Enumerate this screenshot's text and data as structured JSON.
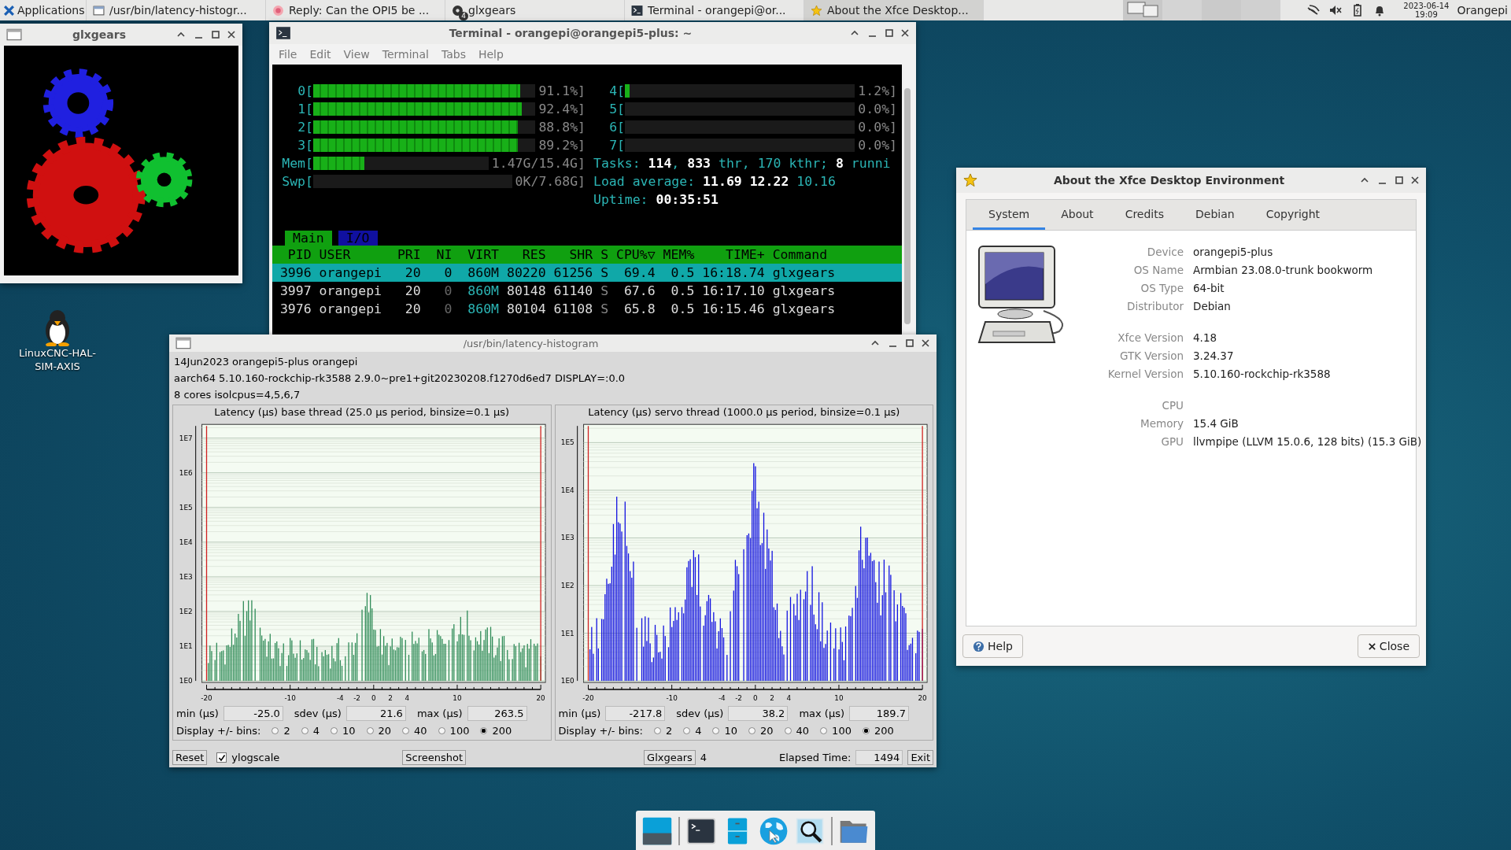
{
  "panel": {
    "tasks": [
      {
        "label": "Applications",
        "kind": "menu",
        "selected": false
      },
      {
        "label": "/usr/bin/latency-histogr...",
        "kind": "window",
        "selected": false
      },
      {
        "label": "Reply: Can the OPI5 be ...",
        "kind": "browser",
        "selected": false
      },
      {
        "label": "glxgears",
        "kind": "gears",
        "badge": "4",
        "selected": false
      },
      {
        "label": "Terminal - orangepi@or...",
        "kind": "terminal",
        "selected": false
      },
      {
        "label": "About the Xfce Desktop...",
        "kind": "star",
        "selected": true
      }
    ],
    "clock": {
      "date": "2023-06-14",
      "time": "19:09"
    },
    "user": "Orangepi"
  },
  "glxgears": {
    "title": "glxgears"
  },
  "desktop_icons": [
    {
      "label": "LinuxCNC-HAL-SIM-AXIS"
    }
  ],
  "terminal": {
    "title": "Terminal - orangepi@orangepi5-plus: ~",
    "menu": [
      "File",
      "Edit",
      "View",
      "Terminal",
      "Tabs",
      "Help"
    ],
    "left_meters": [
      {
        "label": "0[",
        "level": 0.93,
        "reading": "91.1%]"
      },
      {
        "label": "1[",
        "level": 0.94,
        "reading": "92.4%]"
      },
      {
        "label": "2[",
        "level": 0.92,
        "reading": "88.8%]"
      },
      {
        "label": "3[",
        "level": 0.92,
        "reading": "89.2%]"
      },
      {
        "label": "Mem[",
        "level": 0.29,
        "reading": "1.47G/15.4G]"
      },
      {
        "label": "Swp[",
        "reading": "0K/7.68G]"
      }
    ],
    "right_meters": [
      {
        "label": "4[",
        "level": 0.02,
        "reading": "1.2%]"
      },
      {
        "label": "5[",
        "reading": "0.0%]"
      },
      {
        "label": "6[",
        "reading": "0.0%]"
      },
      {
        "label": "7[",
        "reading": "0.0%]"
      }
    ],
    "stats": [
      "Tasks: **114**, **833** thr, 170 kthr; **8** runni",
      "Load average: **11.69 12.22** 10.16",
      "Uptime: **00:35:51**"
    ],
    "tabs": [
      {
        "label": "Main",
        "selected": true
      },
      {
        "label": "I/O",
        "selected": false
      }
    ],
    "columns": [
      "PID",
      "USER",
      "PRI",
      "NI",
      "VIRT",
      "RES",
      "SHR",
      "S",
      "CPU%▽",
      "MEM%",
      "TIME+",
      "Command"
    ],
    "rows": [
      {
        "selected": true,
        "cells": [
          "3996",
          "orangepi",
          "20",
          "0",
          "860M",
          "80220",
          "61256",
          "S",
          "69.4",
          "0.5",
          "16:18.74",
          "glxgears"
        ]
      },
      {
        "selected": false,
        "cells": [
          "3997",
          "orangepi",
          "20",
          "0",
          "860M",
          "80148",
          "61140",
          "S",
          "67.6",
          "0.5",
          "16:17.10",
          "glxgears"
        ]
      },
      {
        "selected": false,
        "cells": [
          "3976",
          "orangepi",
          "20",
          "0",
          "860M",
          "80104",
          "61108",
          "S",
          "65.8",
          "0.5",
          "16:15.46",
          "glxgears"
        ]
      }
    ]
  },
  "histogram": {
    "title": "/usr/bin/latency-histogram",
    "info": [
      "14Jun2023 orangepi5-plus orangepi",
      "aarch64  5.10.160-rockchip-rk3588  2.9.0~pre1+git20230208.f1270d6ed7  DISPLAY=:0.0",
      "8 cores  isolcpus=4,5,6,7"
    ],
    "panels": [
      {
        "title": "Latency (µs) base thread (25.0 µs period, binsize=0.1 µs)",
        "kind": "base",
        "y_ticks": [
          "1E7",
          "1E6",
          "1E5",
          "1E4",
          "1E3",
          "1E2",
          "1E1",
          "1E0"
        ],
        "x_ticks": [
          "-20",
          "-10",
          "-4",
          "-2",
          "0",
          "2",
          "4",
          "10",
          "20"
        ],
        "stats": [
          {
            "label": "min (µs)",
            "value": "-25.0"
          },
          {
            "label": "sdev (µs)",
            "value": "21.6"
          },
          {
            "label": "max (µs)",
            "value": "263.5"
          }
        ],
        "bins_label": "Display +/- bins:",
        "bins": [
          {
            "label": "2",
            "selected": false
          },
          {
            "label": "4",
            "selected": false
          },
          {
            "label": "10",
            "selected": false
          },
          {
            "label": "20",
            "selected": false
          },
          {
            "label": "40",
            "selected": false
          },
          {
            "label": "100",
            "selected": false
          },
          {
            "label": "200",
            "selected": true
          }
        ]
      },
      {
        "title": "Latency (µs) servo thread (1000.0 µs period, binsize=0.1 µs)",
        "kind": "servo",
        "y_ticks": [
          "1E5",
          "1E4",
          "1E3",
          "1E2",
          "1E1",
          "1E0"
        ],
        "x_ticks": [
          "-20",
          "-10",
          "-4",
          "-2",
          "0",
          "2",
          "4",
          "10",
          "20"
        ],
        "stats": [
          {
            "label": "min (µs)",
            "value": "-217.8"
          },
          {
            "label": "sdev (µs)",
            "value": "38.2"
          },
          {
            "label": "max (µs)",
            "value": "189.7"
          }
        ],
        "bins_label": "Display +/- bins:",
        "bins": [
          {
            "label": "2",
            "selected": false
          },
          {
            "label": "4",
            "selected": false
          },
          {
            "label": "10",
            "selected": false
          },
          {
            "label": "20",
            "selected": false
          },
          {
            "label": "40",
            "selected": false
          },
          {
            "label": "100",
            "selected": false
          },
          {
            "label": "200",
            "selected": true
          }
        ]
      }
    ],
    "reset": "Reset",
    "ylogscale": {
      "label": "ylogscale",
      "checked": true
    },
    "screenshot": "Screenshot",
    "glxgears_button": "Glxgears",
    "glxgears_count": "4",
    "elapsed_label": "Elapsed Time:",
    "elapsed": "1494",
    "exit": "Exit"
  },
  "about": {
    "title": "About the Xfce Desktop Environment",
    "tabs": [
      {
        "label": "System",
        "selected": true
      },
      {
        "label": "About",
        "selected": false
      },
      {
        "label": "Credits",
        "selected": false
      },
      {
        "label": "Debian",
        "selected": false
      },
      {
        "label": "Copyright",
        "selected": false
      }
    ],
    "groups": [
      {
        "rows": [
          {
            "label": "Device",
            "value": "orangepi5-plus"
          },
          {
            "label": "OS Name",
            "value": "Armbian 23.08.0-trunk bookworm"
          },
          {
            "label": "OS Type",
            "value": "64-bit"
          },
          {
            "label": "Distributor",
            "value": "Debian"
          }
        ]
      },
      {
        "rows": [
          {
            "label": "Xfce Version",
            "value": "4.18"
          },
          {
            "label": "GTK Version",
            "value": "3.24.37"
          },
          {
            "label": "Kernel Version",
            "value": "5.10.160-rockchip-rk3588"
          }
        ]
      },
      {
        "rows": [
          {
            "label": "CPU"
          },
          {
            "label": "Memory",
            "value": "15.4 GiB"
          },
          {
            "label": "GPU",
            "value": "llvmpipe (LLVM 15.0.6, 128 bits) (15.3 GiB)"
          }
        ]
      }
    ],
    "help": "Help",
    "close": "Close"
  }
}
